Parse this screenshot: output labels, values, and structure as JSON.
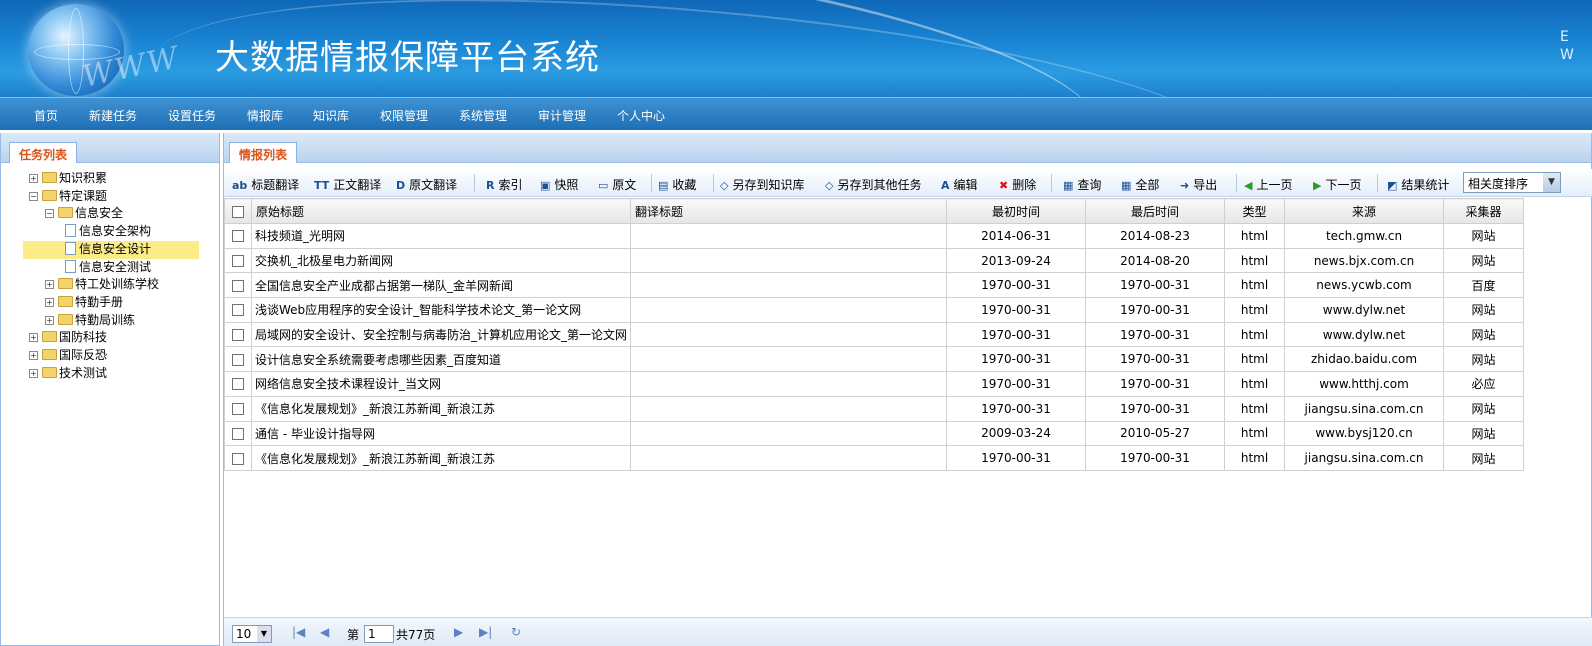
{
  "header": {
    "title": "大数据情报保障平台系统",
    "logo_text": "WWW",
    "corner_text": "E\nW"
  },
  "nav": [
    "首页",
    "新建任务",
    "设置任务",
    "情报库",
    "知识库",
    "权限管理",
    "系统管理",
    "审计管理",
    "个人中心"
  ],
  "left_panel": {
    "tab_title": "任务列表",
    "tree": [
      {
        "label": "知识积累",
        "type": "folder",
        "expander": "+"
      },
      {
        "label": "特定课题",
        "type": "folder",
        "expander": "−"
      },
      {
        "label": "信息安全",
        "type": "folder",
        "expander": "−"
      },
      {
        "label": "信息安全架构",
        "type": "doc",
        "expander": ""
      },
      {
        "label": "信息安全设计",
        "type": "doc",
        "expander": "",
        "selected": true
      },
      {
        "label": "信息安全测试",
        "type": "doc",
        "expander": ""
      },
      {
        "label": "特工处训练学校",
        "type": "folder",
        "expander": "+"
      },
      {
        "label": "特勤手册",
        "type": "folder",
        "expander": "+"
      },
      {
        "label": "特勤局训练",
        "type": "folder",
        "expander": "+"
      },
      {
        "label": "国防科技",
        "type": "folder",
        "expander": "+"
      },
      {
        "label": "国际反恐",
        "type": "folder",
        "expander": "+"
      },
      {
        "label": "技术测试",
        "type": "folder",
        "expander": "+"
      }
    ]
  },
  "right_panel": {
    "tab_title": "情报列表",
    "toolbar": [
      {
        "icon": "ab",
        "label": "标题翻译"
      },
      {
        "icon": "TT",
        "label": "正文翻译"
      },
      {
        "icon": "D",
        "label": "原文翻译"
      },
      {
        "icon": "R",
        "label": "索引"
      },
      {
        "icon": "▣",
        "label": "快照"
      },
      {
        "icon": "▭",
        "label": "原文"
      },
      {
        "icon": "▤",
        "label": "收藏"
      },
      {
        "icon": "◇",
        "label": "另存到知识库"
      },
      {
        "icon": "◇",
        "label": "另存到其他任务"
      },
      {
        "icon": "A",
        "label": "编辑"
      },
      {
        "icon": "✖",
        "label": "删除"
      },
      {
        "icon": "▦",
        "label": "查询"
      },
      {
        "icon": "▦",
        "label": "全部"
      },
      {
        "icon": "➜",
        "label": "导出"
      },
      {
        "icon": "◀",
        "label": "上一页"
      },
      {
        "icon": "▶",
        "label": "下一页"
      },
      {
        "icon": "◩",
        "label": "结果统计"
      }
    ],
    "sort_select": "相关度排序",
    "columns": [
      "原始标题",
      "翻译标题",
      "最初时间",
      "最后时间",
      "类型",
      "来源",
      "采集器"
    ],
    "rows": [
      {
        "title": "科技频道_光明网",
        "translated": "",
        "first": "2014-06-31",
        "last": "2014-08-23",
        "type": "html",
        "source": "tech.gmw.cn",
        "collector": "网站"
      },
      {
        "title": "交换机_北极星电力新闻网",
        "translated": "",
        "first": "2013-09-24",
        "last": "2014-08-20",
        "type": "html",
        "source": "news.bjx.com.cn",
        "collector": "网站"
      },
      {
        "title": "全国信息安全产业成都占据第一梯队_金羊网新闻",
        "translated": "",
        "first": "1970-00-31",
        "last": "1970-00-31",
        "type": "html",
        "source": "news.ycwb.com",
        "collector": "百度"
      },
      {
        "title": "浅谈Web应用程序的安全设计_智能科学技术论文_第一论文网",
        "translated": "",
        "first": "1970-00-31",
        "last": "1970-00-31",
        "type": "html",
        "source": "www.dylw.net",
        "collector": "网站"
      },
      {
        "title": "局域网的安全设计、安全控制与病毒防治_计算机应用论文_第一论文网",
        "translated": "",
        "first": "1970-00-31",
        "last": "1970-00-31",
        "type": "html",
        "source": "www.dylw.net",
        "collector": "网站"
      },
      {
        "title": "设计信息安全系统需要考虑哪些因素_百度知道",
        "translated": "",
        "first": "1970-00-31",
        "last": "1970-00-31",
        "type": "html",
        "source": "zhidao.baidu.com",
        "collector": "网站"
      },
      {
        "title": "网络信息安全技术课程设计_当文网",
        "translated": "",
        "first": "1970-00-31",
        "last": "1970-00-31",
        "type": "html",
        "source": "www.htthj.com",
        "collector": "必应"
      },
      {
        "title": "《信息化发展规划》_新浪江苏新闻_新浪江苏",
        "translated": "",
        "first": "1970-00-31",
        "last": "1970-00-31",
        "type": "html",
        "source": "jiangsu.sina.com.cn",
        "collector": "网站"
      },
      {
        "title": "通信 - 毕业设计指导网",
        "translated": "",
        "first": "2009-03-24",
        "last": "2010-05-27",
        "type": "html",
        "source": "www.bysj120.cn",
        "collector": "网站"
      },
      {
        "title": "《信息化发展规划》_新浪江苏新闻_新浪江苏",
        "translated": "",
        "first": "1970-00-31",
        "last": "1970-00-31",
        "type": "html",
        "source": "jiangsu.sina.com.cn",
        "collector": "网站"
      }
    ],
    "pager": {
      "page_size": "10",
      "page_prefix": "第",
      "page": "1",
      "total_suffix": "共77页"
    }
  }
}
